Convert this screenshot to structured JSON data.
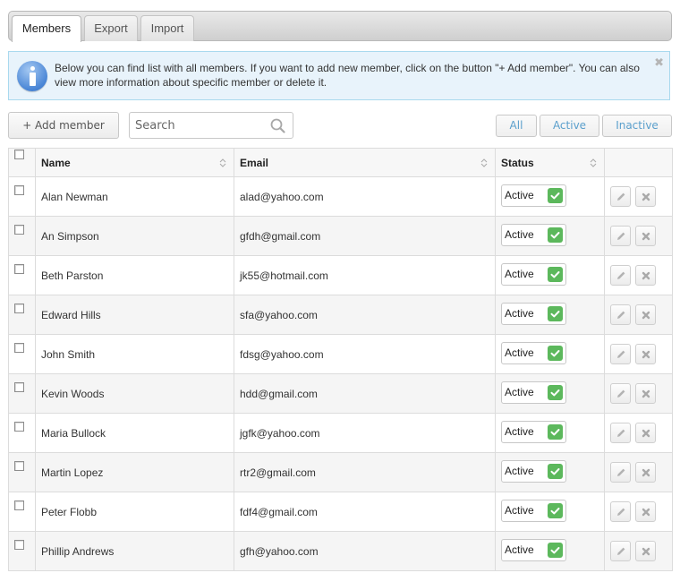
{
  "tabs": [
    {
      "label": "Members",
      "active": true
    },
    {
      "label": "Export",
      "active": false
    },
    {
      "label": "Import",
      "active": false
    }
  ],
  "alert": {
    "icon": "info-icon",
    "message": "Below you can find list with all members. If you want to add new member, click on the button \"+ Add member\". You can also view more information about specific member or delete it.",
    "close_label": "✖"
  },
  "toolbar": {
    "add_label": "+ Add member",
    "search_placeholder": "Search",
    "search_value": "",
    "filters": [
      "All",
      "Active",
      "Inactive"
    ]
  },
  "table": {
    "columns": [
      "Name",
      "Email",
      "Status"
    ],
    "rows": [
      {
        "name": "Alan Newman",
        "email": "alad@yahoo.com",
        "status": "Active"
      },
      {
        "name": "An Simpson",
        "email": "gfdh@gmail.com",
        "status": "Active"
      },
      {
        "name": "Beth Parston",
        "email": "jk55@hotmail.com",
        "status": "Active"
      },
      {
        "name": "Edward Hills",
        "email": "sfa@yahoo.com",
        "status": "Active"
      },
      {
        "name": "John Smith",
        "email": "fdsg@yahoo.com",
        "status": "Active"
      },
      {
        "name": "Kevin Woods",
        "email": "hdd@gmail.com",
        "status": "Active"
      },
      {
        "name": "Maria Bullock",
        "email": "jgfk@yahoo.com",
        "status": "Active"
      },
      {
        "name": "Martin Lopez",
        "email": "rtr2@gmail.com",
        "status": "Active"
      },
      {
        "name": "Peter Flobb",
        "email": "fdf4@gmail.com",
        "status": "Active"
      },
      {
        "name": "Phillip Andrews",
        "email": "gfh@yahoo.com",
        "status": "Active"
      }
    ]
  },
  "colors": {
    "status_active": "#5cb85c",
    "filter_text": "#5a9fcc",
    "alert_bg": "#e8f3fb",
    "alert_border": "#a9d9ee",
    "info_icon": "#4a86d6"
  }
}
